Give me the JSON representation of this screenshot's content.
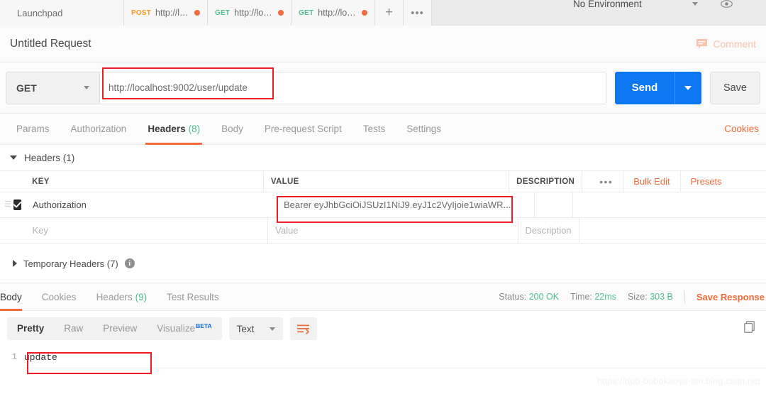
{
  "tabbar": {
    "launchpad_label": "Launchpad",
    "tabs": [
      {
        "method": "POST",
        "url": "http://localhos..."
      },
      {
        "method": "GET",
        "url": "http://localhost:..."
      },
      {
        "method": "GET",
        "url": "http://localhost:..."
      }
    ],
    "new_tab_label": "+",
    "more_label": "•••",
    "environment": "No Environment",
    "eye_icon": "eye-icon"
  },
  "title": {
    "request_name": "Untitled Request",
    "comment_label": "Comment",
    "comment_icon": "comment-icon"
  },
  "url_row": {
    "method": "GET",
    "url": "http://localhost:9002/user/update",
    "send_label": "Send",
    "save_label": "Save"
  },
  "request_tabs": {
    "items": [
      {
        "label": "Params",
        "count": "",
        "active": false
      },
      {
        "label": "Authorization",
        "count": "",
        "active": false
      },
      {
        "label": "Headers",
        "count": "(8)",
        "active": true
      },
      {
        "label": "Body",
        "count": "",
        "active": false
      },
      {
        "label": "Pre-request Script",
        "count": "",
        "active": false
      },
      {
        "label": "Tests",
        "count": "",
        "active": false
      },
      {
        "label": "Settings",
        "count": "",
        "active": false
      }
    ],
    "cookies_label": "Cookies"
  },
  "headers_section": {
    "collapse_label": "Headers (1)",
    "columns": {
      "key": "KEY",
      "value": "VALUE",
      "description": "DESCRIPTION"
    },
    "tools": {
      "dots": "•••",
      "bulk_edit": "Bulk Edit",
      "presets": "Presets"
    },
    "rows": [
      {
        "checked": true,
        "key": "Authorization",
        "value": "Bearer eyJhbGciOiJSUzI1NiJ9.eyJ1c2VyIjoie1wiaWR...",
        "description": ""
      }
    ],
    "placeholder_row": {
      "key": "Key",
      "value": "Value",
      "description": "Description"
    },
    "temporary_headers_label": "Temporary Headers (7)",
    "info_icon": "info-icon"
  },
  "response": {
    "tabs": [
      {
        "label": "Body",
        "count": "",
        "active": true
      },
      {
        "label": "Cookies",
        "count": "",
        "active": false
      },
      {
        "label": "Headers",
        "count": "(9)",
        "active": false
      },
      {
        "label": "Test Results",
        "count": "",
        "active": false
      }
    ],
    "status_label": "Status:",
    "status_value": "200 OK",
    "time_label": "Time:",
    "time_value": "22ms",
    "size_label": "Size:",
    "size_value": "303 B",
    "save_response_label": "Save Response",
    "view_modes": [
      {
        "label": "Pretty",
        "active": true
      },
      {
        "label": "Raw",
        "active": false
      },
      {
        "label": "Preview",
        "active": false
      },
      {
        "label": "Visualize",
        "active": false,
        "badge": "BETA"
      }
    ],
    "format": "Text",
    "wrap_icon": "wrap-lines-icon",
    "copy_icon": "copy-icon",
    "body_line_number": "1",
    "body_text": "update"
  },
  "watermark": "https://dpb-bobokaoya-sm.blog.csdn.net",
  "colors": {
    "accent_orange": "#f26b3a",
    "send_blue": "#0d78f2",
    "success_green": "#4fc08d",
    "annotation_red": "#ee1c25",
    "post_orange": "#ff9a1f"
  }
}
